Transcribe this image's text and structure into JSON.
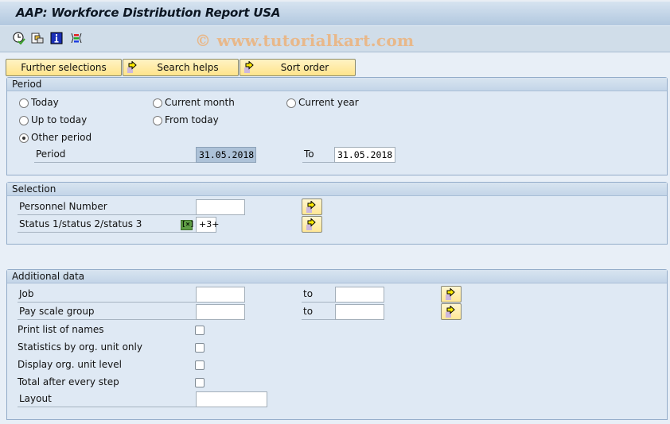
{
  "window": {
    "title": "AAP: Workforce Distribution Report USA"
  },
  "toolbar": {
    "icons": [
      "execute-clock-icon",
      "variants-icon",
      "info-icon",
      "selection-options-icon"
    ],
    "watermark": "© www.tutorialkart.com"
  },
  "appbar": {
    "buttons": [
      {
        "label": "Further selections",
        "icon": null
      },
      {
        "label": "Search helps",
        "icon": "arrow-right-icon"
      },
      {
        "label": "Sort order",
        "icon": "arrow-right-icon"
      }
    ]
  },
  "period": {
    "header": "Period",
    "radios": [
      {
        "label": "Today",
        "checked": false
      },
      {
        "label": "Current month",
        "checked": false
      },
      {
        "label": "Current year",
        "checked": false
      },
      {
        "label": "Up to today",
        "checked": false
      },
      {
        "label": "From today",
        "checked": false
      },
      {
        "label": "Other period",
        "checked": true
      }
    ],
    "period_label": "Period",
    "from_value": "31.05.2018",
    "to_label": "To",
    "to_value": "31.05.2018"
  },
  "selection": {
    "header": "Selection",
    "rows": [
      {
        "label": "Personnel Number",
        "value": ""
      },
      {
        "label": "Status 1/status 2/status 3",
        "value": "+3+",
        "multi_icon": "[×]"
      }
    ]
  },
  "additional": {
    "header": "Additional data",
    "ranges": [
      {
        "label": "Job",
        "from": "",
        "to_label": "to",
        "to": ""
      },
      {
        "label": "Pay scale group",
        "from": "",
        "to_label": "to",
        "to": ""
      }
    ],
    "checkboxes": [
      {
        "label": "Print list of names",
        "checked": false
      },
      {
        "label": "Statistics by org. unit only",
        "checked": false
      },
      {
        "label": "Display org. unit level",
        "checked": false
      },
      {
        "label": "Total after every step",
        "checked": false
      }
    ],
    "layout_label": "Layout",
    "layout_value": ""
  }
}
